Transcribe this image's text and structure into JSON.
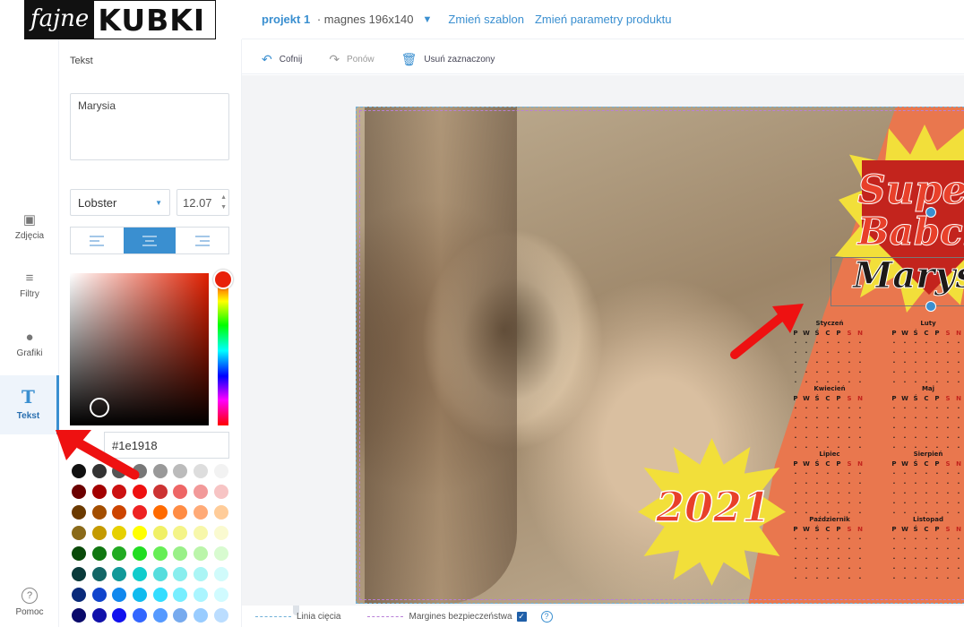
{
  "logo": {
    "script": "fajne",
    "bold": "KUBKI"
  },
  "topbar": {
    "project": "projekt 1",
    "separator": "·",
    "product": "magnes 196x140",
    "change_template": "Zmień szablon",
    "change_params": "Zmień parametry produktu"
  },
  "rail": [
    {
      "label": "Zdjęcia",
      "icon": "image-icon"
    },
    {
      "label": "Filtry",
      "icon": "sliders-icon"
    },
    {
      "label": "Grafiki",
      "icon": "drop-icon"
    },
    {
      "label": "Tekst",
      "icon": "text-icon",
      "active": true
    },
    {
      "label": "Pomoc",
      "icon": "help-icon"
    }
  ],
  "panel": {
    "title": "Tekst",
    "text_value": "Marysia",
    "font": "Lobster",
    "font_size": "12.07",
    "hex_value": "#1e1918",
    "alignment": "center"
  },
  "swatches": [
    "#111111",
    "#333333",
    "#555555",
    "#777777",
    "#999999",
    "#bbbbbb",
    "#dddddd",
    "#f2f2f2",
    "#6b0000",
    "#a30000",
    "#cc1111",
    "#ee1111",
    "#cc3333",
    "#ee6666",
    "#f29999",
    "#f7c4c4",
    "#6b3a00",
    "#a34e00",
    "#cc4400",
    "#ee2222",
    "#ff6a00",
    "#ff8c44",
    "#ffaa77",
    "#ffcc99",
    "#8a6a1a",
    "#c49a00",
    "#e6d000",
    "#ffff00",
    "#f0f066",
    "#f4f488",
    "#f7f7aa",
    "#fafad0",
    "#0a4a0a",
    "#117711",
    "#22aa22",
    "#22dd22",
    "#66ee55",
    "#99f088",
    "#bbf5aa",
    "#d8fbd0",
    "#0a3a3a",
    "#136666",
    "#129999",
    "#11cccc",
    "#55dddd",
    "#88eeee",
    "#aaf5f5",
    "#d0fbfb",
    "#0a2a7a",
    "#1144cc",
    "#1188ee",
    "#11bbee",
    "#33ddff",
    "#77eeff",
    "#aaf5ff",
    "#d0fbff",
    "#0a0a6a",
    "#1111aa",
    "#1111ee",
    "#3366ff",
    "#5599ff",
    "#77aaee",
    "#99ccff",
    "#bbddff"
  ],
  "toolbar": {
    "undo": "Cofnij",
    "redo": "Ponów",
    "delete": "Usuń zaznaczony"
  },
  "design": {
    "headline_1": "Supe",
    "headline_2": "Babci",
    "name": "Marys",
    "year": "2021",
    "months": [
      {
        "name": "Styczeń",
        "days": "P W Ś C P S N"
      },
      {
        "name": "Luty",
        "days": "P W Ś C P S N"
      },
      {
        "name": "Kwiecień",
        "days": "P W Ś C P S N"
      },
      {
        "name": "Maj",
        "days": "P W Ś C P S N"
      },
      {
        "name": "Lipiec",
        "days": "P W Ś C P S N"
      },
      {
        "name": "Sierpień",
        "days": "P W Ś C P S N"
      },
      {
        "name": "Październik",
        "days": "P W Ś C P S N"
      },
      {
        "name": "Listopad",
        "days": "P W Ś C P S N"
      }
    ]
  },
  "footer": {
    "cut_line": "Linia cięcia",
    "safe_margin": "Margines bezpieczeństwa"
  },
  "colors": {
    "accent": "#3a8fd0",
    "annotation_arrow": "#ee1111",
    "calendar_bg": "#e9774e"
  }
}
